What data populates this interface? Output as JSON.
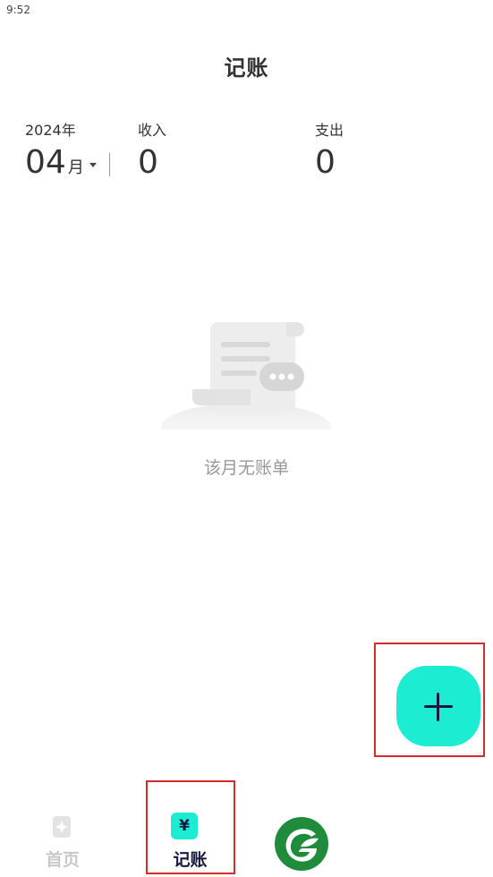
{
  "status": {
    "time": "9:52"
  },
  "header": {
    "title": "记账"
  },
  "summary": {
    "year": "2024年",
    "month": "04",
    "month_suffix": "月",
    "income_label": "收入",
    "income_value": "0",
    "expense_label": "支出",
    "expense_value": "0"
  },
  "empty_state": {
    "message": "该月无账单"
  },
  "fab": {
    "icon": "plus-icon",
    "color": "#1cecd2"
  },
  "tabbar": {
    "items": [
      {
        "label": "首页",
        "icon": "home-sparkle-icon",
        "active": false
      },
      {
        "label": "记账",
        "icon": "yen-book-icon",
        "active": true
      },
      {
        "label": "",
        "icon": "brand-leaf-icon",
        "active": false
      }
    ]
  },
  "colors": {
    "accent": "#1cecd2",
    "brand_green": "#1e8c3a",
    "highlight_box": "#d62b2b",
    "label_dark": "#1a1a40"
  }
}
